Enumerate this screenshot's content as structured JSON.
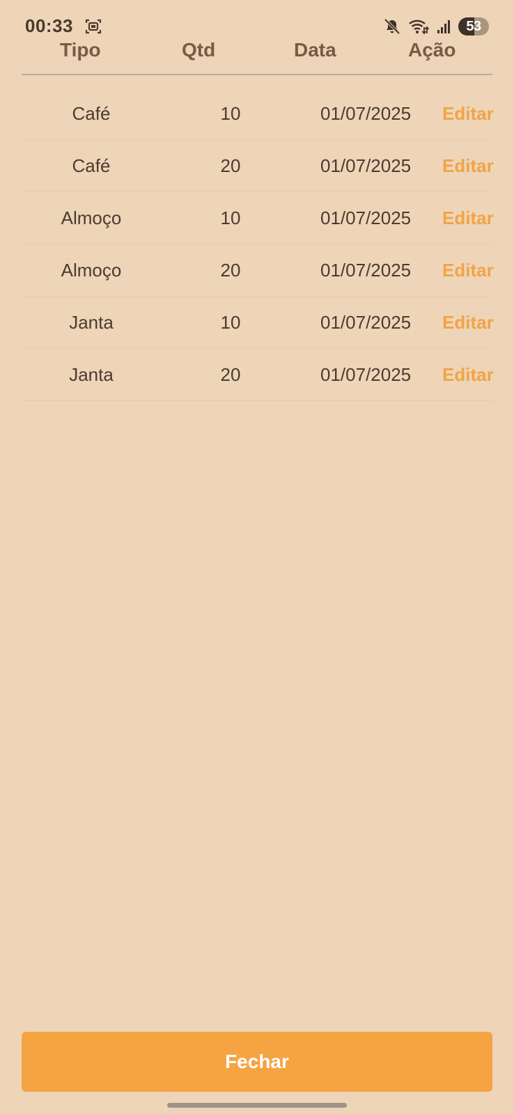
{
  "status_bar": {
    "time": "00:33",
    "battery": "53",
    "battery_level_percent": 53,
    "icons": [
      "screenshot-icon",
      "mute-icon",
      "wifi-icon",
      "signal-icon",
      "battery-icon"
    ]
  },
  "table": {
    "headers": {
      "tipo": "Tipo",
      "qtd": "Qtd",
      "data": "Data",
      "acao": "Ação"
    },
    "rows": [
      {
        "tipo": "Café",
        "qtd": "10",
        "data": "01/07/2025",
        "acao": "Editar"
      },
      {
        "tipo": "Café",
        "qtd": "20",
        "data": "01/07/2025",
        "acao": "Editar"
      },
      {
        "tipo": "Almoço",
        "qtd": "10",
        "data": "01/07/2025",
        "acao": "Editar"
      },
      {
        "tipo": "Almoço",
        "qtd": "20",
        "data": "01/07/2025",
        "acao": "Editar"
      },
      {
        "tipo": "Janta",
        "qtd": "10",
        "data": "01/07/2025",
        "acao": "Editar"
      },
      {
        "tipo": "Janta",
        "qtd": "20",
        "data": "01/07/2025",
        "acao": "Editar"
      }
    ]
  },
  "close_button": {
    "label": "Fechar"
  },
  "colors": {
    "background": "#EED5B7",
    "header_text": "#7a5a45",
    "body_text": "#4a3b30",
    "accent": "#f5a441",
    "edit_link": "#f2a347"
  }
}
